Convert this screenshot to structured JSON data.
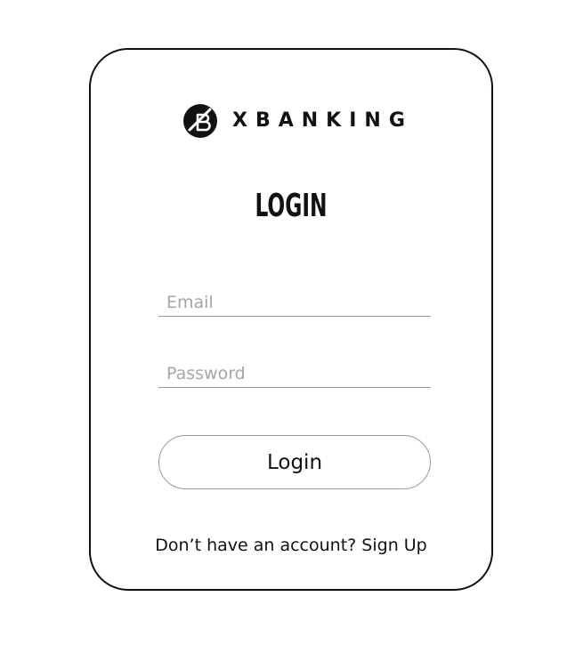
{
  "brand": {
    "name": "XBANKING",
    "logo_icon": "xb-logo-icon"
  },
  "form": {
    "title": "LOGIN",
    "email": {
      "placeholder": "Email",
      "value": ""
    },
    "password": {
      "placeholder": "Password",
      "value": ""
    },
    "submit_label": "Login"
  },
  "signup": {
    "prompt": "Don’t have an account?",
    "link_label": "Sign Up"
  },
  "colors": {
    "text": "#111111",
    "border": "#111111",
    "field_line": "#9a9a9a",
    "placeholder": "#a6a6a6",
    "background": "#ffffff"
  }
}
